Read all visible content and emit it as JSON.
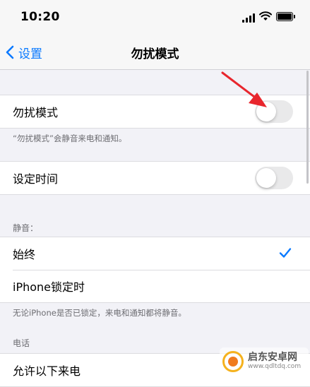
{
  "status_bar": {
    "time": "10:20"
  },
  "nav": {
    "back_label": "设置",
    "title": "勿扰模式"
  },
  "dnd_group": {
    "label": "勿扰模式",
    "toggle_on": false,
    "footnote": "“勿扰模式”会静音来电和通知。"
  },
  "schedule_group": {
    "label": "设定时间",
    "toggle_on": false
  },
  "silence": {
    "header": "静音：",
    "options": [
      {
        "label": "始终",
        "selected": true
      },
      {
        "label": "iPhone锁定时",
        "selected": false
      }
    ],
    "footnote": "无论iPhone是否已锁定，来电和通知都将静音。"
  },
  "phone": {
    "header": "电话",
    "allow_calls_label": "允许以下来电"
  },
  "watermark": {
    "name": "启东安卓网",
    "url": "www.qdltdq.com"
  },
  "colors": {
    "accent": "#0a7aff",
    "annotation_arrow": "#e8262d",
    "background": "#f2f2f7"
  }
}
